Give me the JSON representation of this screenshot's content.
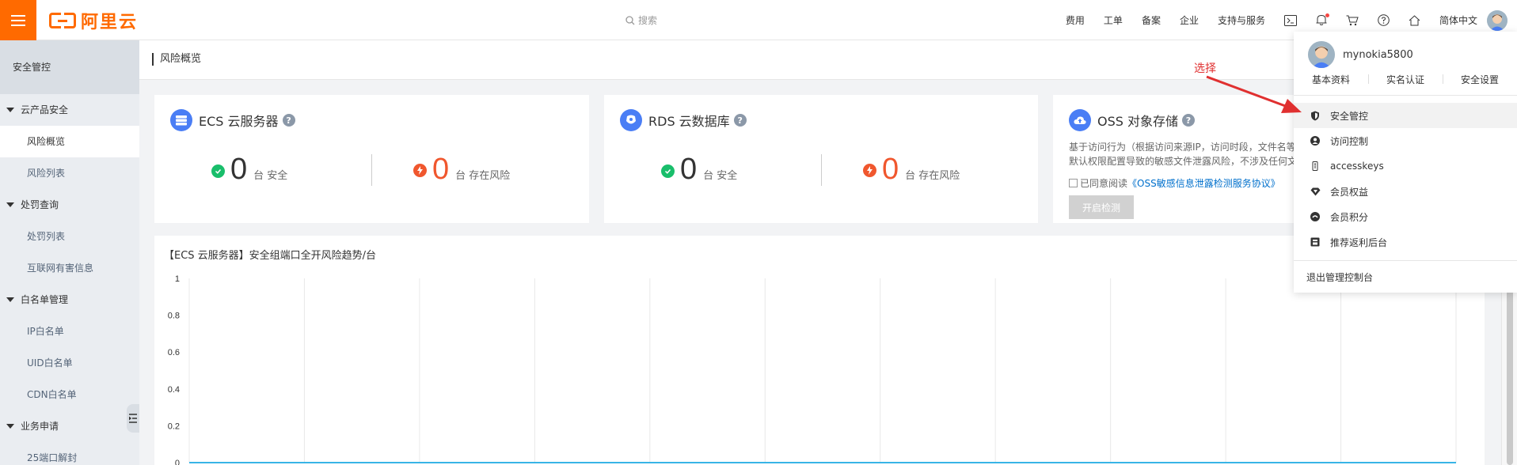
{
  "header": {
    "logo_text": "阿里云",
    "search_placeholder": "搜索",
    "nav": [
      "费用",
      "工单",
      "备案",
      "企业",
      "支持与服务"
    ],
    "language": "简体中文"
  },
  "sidebar": {
    "title": "安全管控",
    "groups": [
      {
        "label": "云产品安全",
        "items": [
          "风险概览",
          "风险列表"
        ]
      },
      {
        "label": "处罚查询",
        "items": [
          "处罚列表",
          "互联网有害信息"
        ]
      },
      {
        "label": "白名单管理",
        "items": [
          "IP白名单",
          "UID白名单",
          "CDN白名单"
        ]
      },
      {
        "label": "业务申请",
        "items": [
          "25端口解封"
        ]
      }
    ],
    "active_item": "风险概览"
  },
  "page": {
    "title": "风险概览"
  },
  "cards": {
    "ecs": {
      "title": "ECS 云服务器",
      "safe_count": "0",
      "safe_label": "台 安全",
      "risk_count": "0",
      "risk_label": "台 存在风险"
    },
    "rds": {
      "title": "RDS 云数据库",
      "safe_count": "0",
      "safe_label": "台 安全",
      "risk_count": "0",
      "risk_label": "台 存在风险"
    },
    "oss": {
      "title": "OSS 对象存储",
      "desc_line1": "基于访问行为（根据访问来源IP，访问时段，文件名等",
      "desc_line2": "默认权限配置导致的敏感文件泄露风险，不涉及任何文",
      "agree_prefix": "已同意阅读",
      "agree_link": "《OSS敏感信息泄露检测服务协议》",
      "button": "开启检测"
    }
  },
  "chart_data": {
    "type": "line",
    "title": "【ECS 云服务器】安全组端口全开风险趋势/台",
    "ylim": [
      0,
      1
    ],
    "yticks": [
      "1",
      "0.8",
      "0.6",
      "0.4",
      "0.2",
      "0"
    ],
    "series": [
      {
        "values": [
          0,
          0,
          0,
          0,
          0,
          0,
          0,
          0,
          0,
          0,
          0,
          0
        ]
      }
    ],
    "grid": true,
    "colors": {
      "line": "#38b4e6",
      "grid": "#e8e8e8"
    }
  },
  "dropdown": {
    "username": "mynokia5800",
    "links": [
      "基本资料",
      "实名认证",
      "安全设置"
    ],
    "items": [
      "安全管控",
      "访问控制",
      "accesskeys",
      "会员权益",
      "会员积分",
      "推荐返利后台"
    ],
    "active_item": "安全管控",
    "logout": "退出管理控制台"
  },
  "annotation": {
    "text": "选择",
    "color": "#e03030"
  },
  "colors": {
    "brand": "#ff6a00",
    "primary_icon": "#4a7ef5",
    "safe": "#19be6b",
    "risk": "#f0572e",
    "link": "#0070cc"
  }
}
